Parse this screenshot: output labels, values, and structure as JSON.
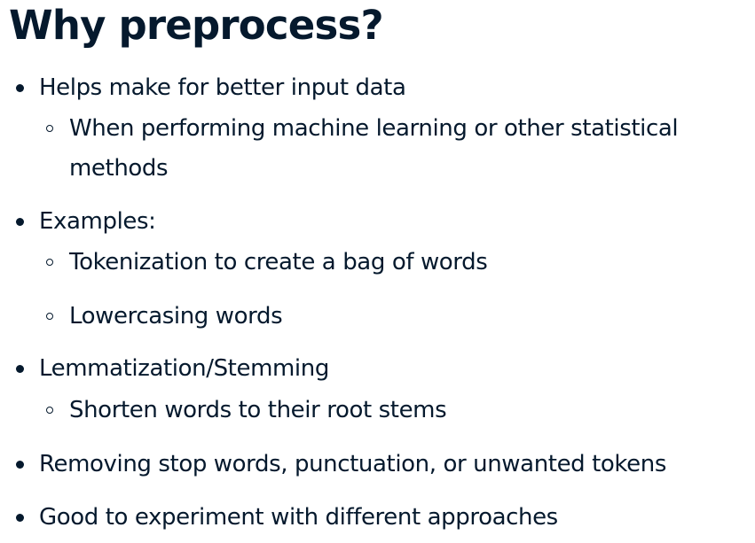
{
  "slide": {
    "title": "Why preprocess?",
    "bullets": [
      {
        "text": "Helps make for better input data",
        "sub": [
          {
            "text_line1": "When performing machine learning or other statistical",
            "text_line2": "methods"
          }
        ]
      },
      {
        "text": "Examples:",
        "sub": [
          {
            "text": "Tokenization to create a bag of words"
          },
          {
            "text": "Lowercasing words"
          }
        ]
      },
      {
        "text": "Lemmatization/Stemming",
        "sub": [
          {
            "text": "Shorten words to their root stems"
          }
        ]
      },
      {
        "text": "Removing stop words, punctuation, or unwanted tokens"
      },
      {
        "text": "Good to experiment with different approaches"
      }
    ]
  }
}
